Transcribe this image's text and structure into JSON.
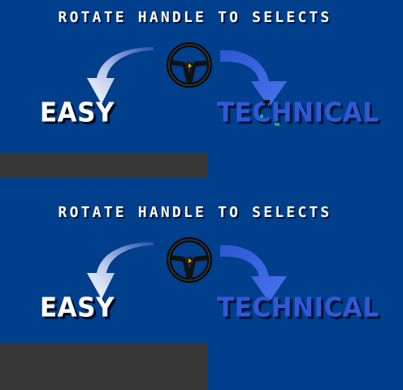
{
  "instruction": "ROTATE HANDLE TO SELECTS",
  "options": {
    "easy": "EASY",
    "technical": "TECHNICAL"
  },
  "selected": "easy",
  "icons": {
    "steering_wheel": "steering-wheel-icon",
    "arrow_left": "curved-arrow-left-icon",
    "arrow_right": "curved-arrow-right-icon"
  },
  "colors": {
    "background": "#003f8c",
    "selected_text": "#ffffff",
    "unselected_text": "#3158d6",
    "panel": "#373737",
    "right_arrow": "#3a64e0"
  }
}
